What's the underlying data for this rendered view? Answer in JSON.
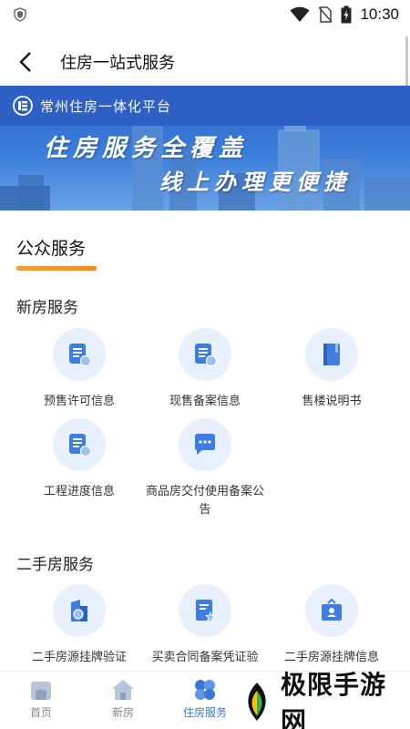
{
  "status_bar": {
    "time": "10:30"
  },
  "app_bar": {
    "title": "住房一站式服务"
  },
  "banner": {
    "brand": "常州住房一体化平台",
    "line1": "住房服务全覆盖",
    "line2": "线上办理更便捷"
  },
  "section": {
    "title": "公众服务"
  },
  "new_house": {
    "title": "新房服务",
    "items": [
      {
        "label": "预售许可信息",
        "icon": "document-badge-icon"
      },
      {
        "label": "现售备案信息",
        "icon": "document-badge-icon"
      },
      {
        "label": "售楼说明书",
        "icon": "book-icon"
      },
      {
        "label": "工程进度信息",
        "icon": "document-badge-icon"
      },
      {
        "label": "商品房交付使用备案公告",
        "icon": "chat-bubble-icon"
      }
    ]
  },
  "second_hand": {
    "title": "二手房服务",
    "items": [
      {
        "label": "二手房源挂牌验证",
        "icon": "building-check-icon"
      },
      {
        "label": "买卖合同备案凭证验",
        "icon": "certificate-star-icon"
      },
      {
        "label": "二手房源挂牌信息",
        "icon": "notice-board-icon"
      }
    ]
  },
  "bottom_nav": {
    "items": [
      {
        "label": "首页",
        "icon": "home-icon"
      },
      {
        "label": "新房",
        "icon": "house-icon"
      },
      {
        "label": "住房服务",
        "icon": "petals-icon",
        "active": true
      }
    ]
  },
  "watermark": {
    "text": "极限手游网"
  },
  "colors": {
    "accent": "#3a78d6",
    "banner_blue": "#2d5fc4",
    "underline": "#f58a1f",
    "icon_bg": "#e8f0fd"
  }
}
